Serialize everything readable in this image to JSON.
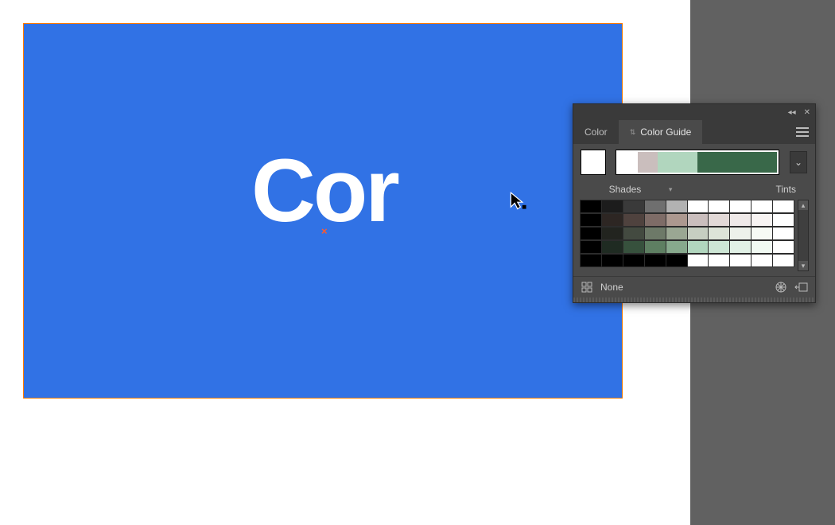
{
  "artboard": {
    "text": "Cor",
    "bg": "#3172e5"
  },
  "panel": {
    "tabs": {
      "color": "Color",
      "colorGuide": "Color Guide"
    },
    "baseColor": "#ffffff",
    "harmony": [
      "#ffffff",
      "#cabebd",
      "#b1d6be",
      "#b1d6be",
      "#396849"
    ],
    "variation": {
      "shades": "Shades",
      "tints": "Tints"
    },
    "grid": [
      [
        "#000000",
        "#1c1c1c",
        "#3a3a3a",
        "#6f6f6f",
        "#b2b2b2",
        "#ffffff",
        "#ffffff",
        "#ffffff",
        "#ffffff",
        "#ffffff"
      ],
      [
        "#000000",
        "#2d2623",
        "#4f423e",
        "#7e6c67",
        "#ac988f",
        "#cabebd",
        "#e2d9d7",
        "#efe9e8",
        "#f8f4f3",
        "#ffffff"
      ],
      [
        "#000000",
        "#22241f",
        "#434a40",
        "#6d7968",
        "#9aa793",
        "#c6cec1",
        "#dde4d8",
        "#edf1ea",
        "#f7faf5",
        "#ffffff"
      ],
      [
        "#000000",
        "#1f2b22",
        "#37513d",
        "#5e7f62",
        "#87a98d",
        "#b1d6be",
        "#cde6d5",
        "#e1f1e6",
        "#f1faf3",
        "#ffffff"
      ],
      [
        "#000000",
        "#000000",
        "#000000",
        "#000000",
        "#000000",
        "#ffffff",
        "#ffffff",
        "#ffffff",
        "#ffffff",
        "#ffffff"
      ]
    ],
    "footer": {
      "none": "None"
    }
  }
}
